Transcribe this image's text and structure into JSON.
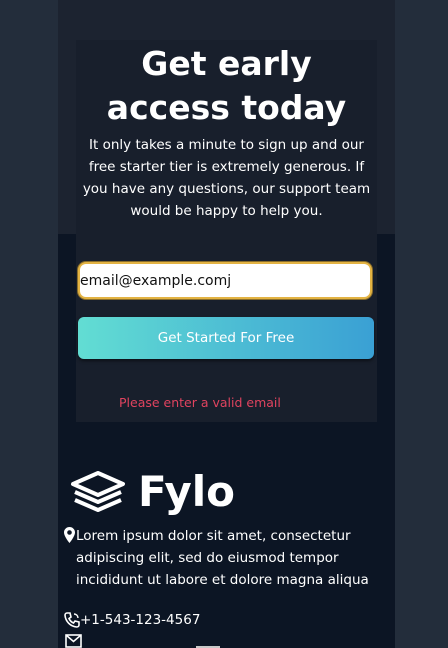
{
  "hero": {
    "title": "Get early access today",
    "description": "It only takes a minute to sign up and our free starter tier is extremely generous. If you have any questions, our support team would be happy to help you."
  },
  "form": {
    "email_value": "email@example.comj",
    "cta_label": "Get Started For Free",
    "error_message": "Please enter a valid email"
  },
  "footer": {
    "brand": "Fylo",
    "address": "Lorem ipsum dolor sit amet, consectetur adipiscing elit, sed do eiusmod tempor incididunt ut labore et dolore magna aliqua",
    "phone": "+1-543-123-4567"
  },
  "colors": {
    "accent_start": "#62ddd3",
    "accent_end": "#3aa0d4",
    "error": "#e0435f",
    "focus_border": "#e3b343"
  },
  "icons": [
    "location-pin-icon",
    "phone-icon",
    "mail-icon",
    "fylo-logo-icon"
  ]
}
